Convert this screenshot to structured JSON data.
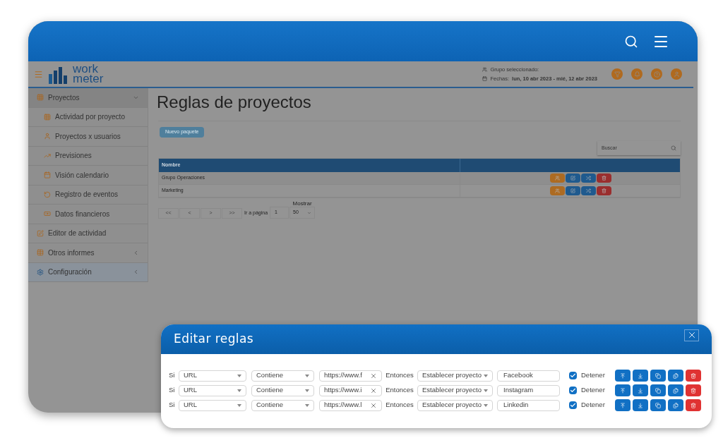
{
  "logo": {
    "line1": "work",
    "line2": "meter"
  },
  "header": {
    "group_label": "Grupo seleccionado:",
    "dates_label": "Fechas:",
    "dates_value": "lun, 10 abr 2023 - mié, 12 abr 2023"
  },
  "sidebar": {
    "items": [
      {
        "label": "Proyectos",
        "kind": "group",
        "expanded": true,
        "selected": false,
        "children": [
          {
            "label": "Actividad por proyecto"
          },
          {
            "label": "Proyectos x usuarios"
          },
          {
            "label": "Previsiones"
          },
          {
            "label": "Visión calendario"
          },
          {
            "label": "Registro de eventos"
          },
          {
            "label": "Datos financieros"
          }
        ]
      },
      {
        "label": "Editor de actividad",
        "kind": "link",
        "selected": false
      },
      {
        "label": "Otros informes",
        "kind": "group",
        "expanded": false,
        "selected": false
      },
      {
        "label": "Configuración",
        "kind": "group",
        "expanded": false,
        "selected": true
      }
    ]
  },
  "page": {
    "title": "Reglas de proyectos",
    "new_button": "Nuevo paquete",
    "search": {
      "placeholder": "Buscar"
    },
    "table": {
      "columns": [
        "Nombre"
      ],
      "rows": [
        {
          "name": "Grupo Operaciones"
        },
        {
          "name": "Marketing"
        }
      ]
    },
    "pagination": {
      "buttons": [
        "<<",
        "<",
        ">",
        ">>"
      ],
      "goto_label": "Ir a página",
      "page": "1",
      "show_label": "Mostrar",
      "page_size": "50"
    }
  },
  "dialog": {
    "title": "Editar reglas",
    "rules": [
      {
        "if_label": "Si",
        "field": "URL",
        "operator": "Contiene",
        "value": "https://www.f",
        "then_label": "Entonces",
        "action": "Establecer proyecto",
        "project": "Facebook",
        "stop_label": "Detener",
        "stop": true
      },
      {
        "if_label": "Si",
        "field": "URL",
        "operator": "Contiene",
        "value": "https://www.i",
        "then_label": "Entonces",
        "action": "Establecer proyecto",
        "project": "Instagram",
        "stop_label": "Detener",
        "stop": true
      },
      {
        "if_label": "Si",
        "field": "URL",
        "operator": "Contiene",
        "value": "https://www.l",
        "then_label": "Entonces",
        "action": "Establecer proyecto",
        "project": "Linkedin",
        "stop_label": "Detener",
        "stop": true
      }
    ]
  }
}
